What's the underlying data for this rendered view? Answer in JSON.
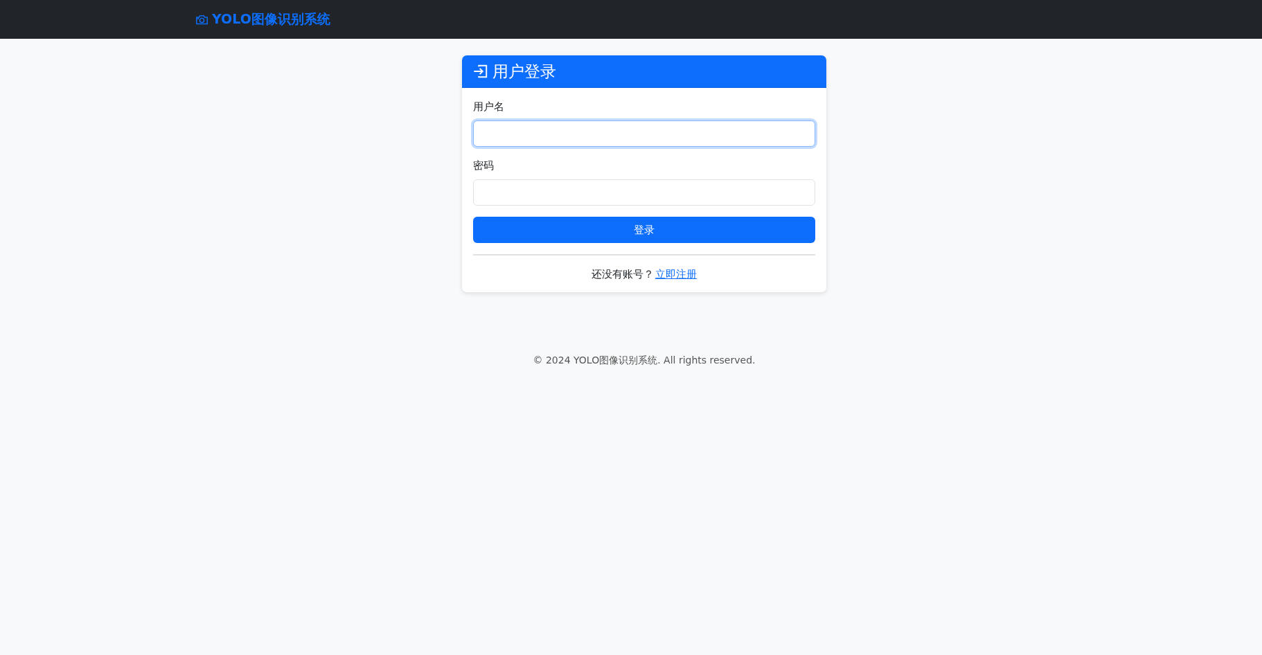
{
  "navbar": {
    "brand": "YOLO图像识别系统"
  },
  "login_card": {
    "title": "用户登录",
    "fields": [
      {
        "label": "用户名",
        "focused": true
      },
      {
        "label": "密码",
        "focused": false
      }
    ],
    "submit": "登录",
    "register_prompt": "还没有账号？",
    "register_link": "立即注册"
  },
  "footer": "© 2024 YOLO图像识别系统. All rights reserved."
}
